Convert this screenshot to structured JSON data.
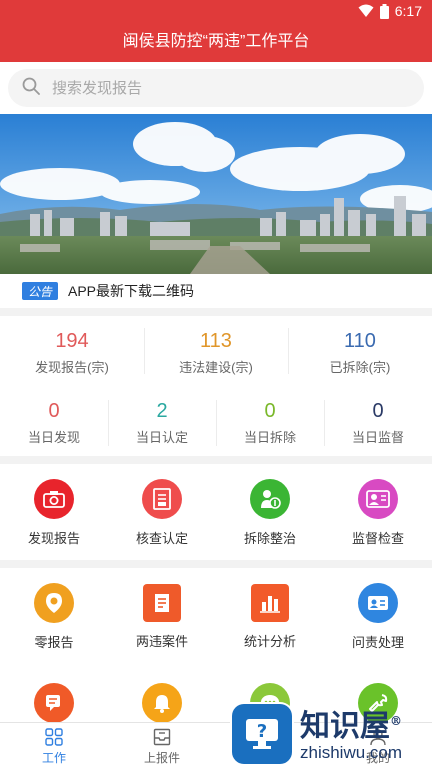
{
  "status_bar": {
    "time": "6:17"
  },
  "app_title": "闽侯县防控“两违”工作平台",
  "search": {
    "placeholder": "搜索发现报告"
  },
  "notice": {
    "tag": "公告",
    "text": "APP最新下载二维码"
  },
  "stats_top": [
    {
      "value": "194",
      "label": "发现报告(宗)",
      "color": "#e05a5a"
    },
    {
      "value": "113",
      "label": "违法建设(宗)",
      "color": "#e0962a"
    },
    {
      "value": "110",
      "label": "已拆除(宗)",
      "color": "#3a6ab0"
    }
  ],
  "stats_today": [
    {
      "value": "0",
      "label": "当日发现",
      "color": "#e05a5a"
    },
    {
      "value": "2",
      "label": "当日认定",
      "color": "#2aa8a0"
    },
    {
      "value": "0",
      "label": "当日拆除",
      "color": "#7ab82a"
    },
    {
      "value": "0",
      "label": "当日监督",
      "color": "#2a3a66"
    }
  ],
  "main_actions": [
    {
      "label": "发现报告",
      "icon": "camera-icon",
      "color": "#e8242c"
    },
    {
      "label": "核查认定",
      "icon": "document-icon",
      "color": "#ef4c4c"
    },
    {
      "label": "拆除整治",
      "icon": "demolish-icon",
      "color": "#3bb534"
    },
    {
      "label": "监督检查",
      "icon": "inspect-icon",
      "color": "#d84ac2"
    }
  ],
  "more_actions": [
    {
      "label": "零报告",
      "icon": "zero-report-icon",
      "color": "#f0a020"
    },
    {
      "label": "两违案件",
      "icon": "case-icon",
      "color": "#ef5a2a"
    },
    {
      "label": "统计分析",
      "icon": "chart-icon",
      "color": "#f25a2a"
    },
    {
      "label": "问责处理",
      "icon": "accountability-icon",
      "color": "#2f86e0"
    },
    {
      "label": "",
      "icon": "message-icon",
      "color": "#f05a28"
    },
    {
      "label": "",
      "icon": "bell-icon",
      "color": "#f5a418"
    },
    {
      "label": "",
      "icon": "chat-icon",
      "color": "#8bc83a"
    },
    {
      "label": "",
      "icon": "tool-icon",
      "color": "#6ac22a"
    }
  ],
  "tabs": [
    {
      "label": "工作",
      "icon": "grid-icon",
      "active": true
    },
    {
      "label": "上报件",
      "icon": "inbox-icon",
      "active": false
    },
    {
      "label": "",
      "icon": "",
      "active": false
    },
    {
      "label": "我的",
      "icon": "user-icon",
      "active": false
    }
  ],
  "watermark": {
    "cn": "知识屋",
    "en": "zhishiwu.com",
    "mark": "®"
  }
}
